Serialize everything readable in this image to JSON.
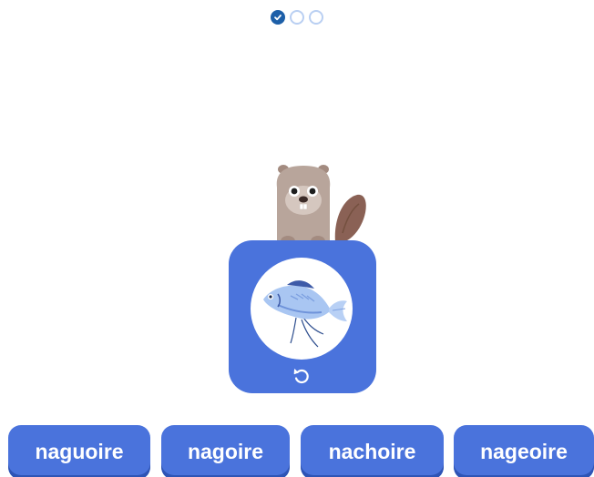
{
  "progress": {
    "current_step": 1,
    "total_steps": 3,
    "completed_steps": 1
  },
  "prompt": {
    "image": "fish-icon",
    "replay_icon": "replay-icon",
    "mascot": "beaver-mascot"
  },
  "choices": [
    {
      "label": "naguoire"
    },
    {
      "label": "nagoire"
    },
    {
      "label": "nachoire"
    },
    {
      "label": "nageoire"
    }
  ],
  "colors": {
    "accent": "#4a73dc",
    "accent_dark": "#2e54b5",
    "progress_done": "#1d5fa8",
    "progress_todo": "#b9cff2"
  }
}
